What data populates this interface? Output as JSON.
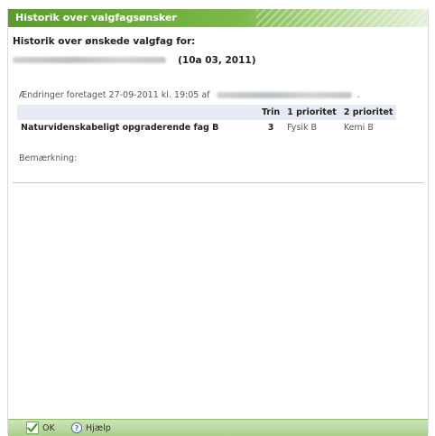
{
  "dialog": {
    "title": "Historik over valgfagsønsker",
    "heading": "Historik over ønskede valgfag for:",
    "class_year": "(10a 03, 2011)",
    "change_prefix": "Ændringer foretaget 27-09-2011 kl. 19:05 af",
    "change_suffix": "."
  },
  "table": {
    "headers": [
      "",
      "Trin",
      "1 prioritet",
      "2 prioritet"
    ],
    "rows": [
      {
        "subject": "Naturvidenskabeligt opgraderende fag B",
        "step": "3",
        "priority1": "Fysik B",
        "priority2": "Kemi B"
      }
    ]
  },
  "remark_label": "Bemærkning:",
  "footer": {
    "ok_label": "OK",
    "help_label": "Hjælp",
    "help_icon": "question-icon",
    "ok_icon": "checkmark-icon"
  },
  "colors": {
    "titlebar": "#5a9c2c",
    "footer": "#b9d99e",
    "table_header": "#e6eaf5",
    "check": "#3d9a1e"
  }
}
